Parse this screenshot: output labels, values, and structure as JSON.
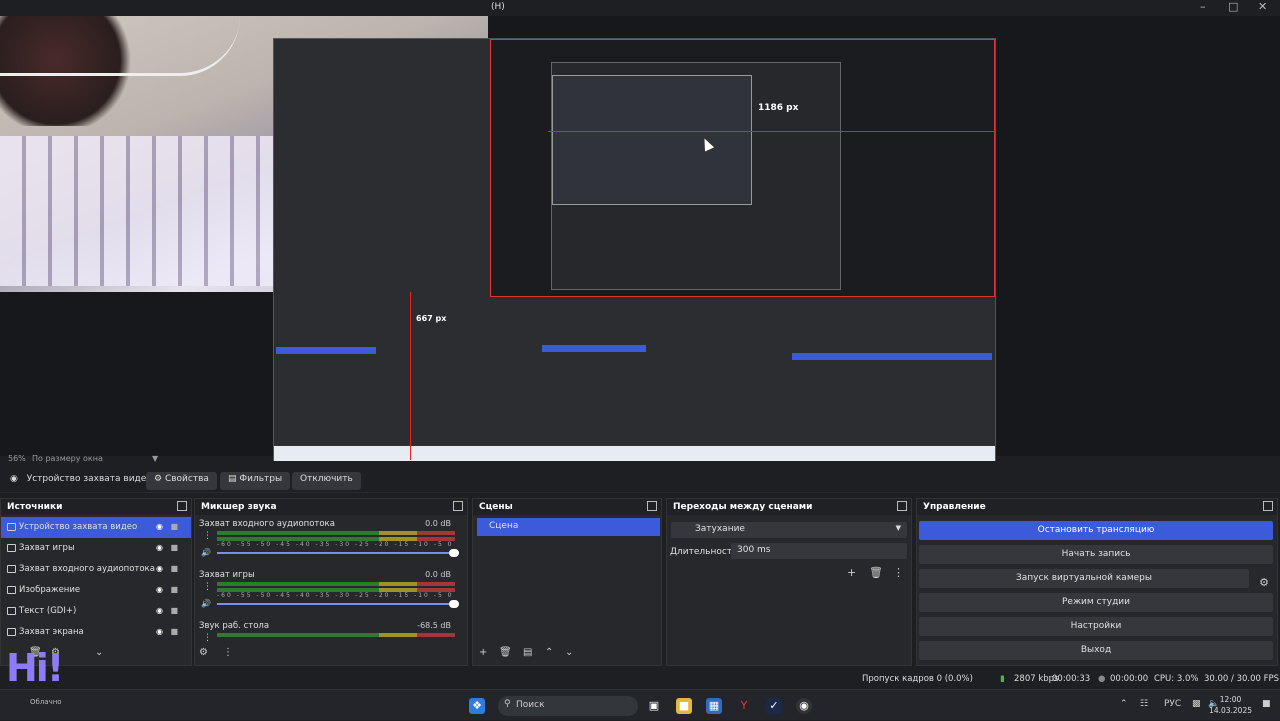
{
  "window": {
    "title": "(H)"
  },
  "preview": {
    "measure_horizontal": "1186 px",
    "measure_vertical": "667 px",
    "zoom_level": "56%",
    "zoom_mode": "По размеру окна"
  },
  "toolbar": {
    "source_name": "Устройство захвата видео",
    "properties": "Свойства",
    "filters": "Фильтры",
    "disable": "Отключить"
  },
  "sources": {
    "title": "Источники",
    "items": [
      {
        "label": "Устройство захвата видео",
        "icon": "camera-icon",
        "selected": true
      },
      {
        "label": "Захват игры",
        "icon": "gamepad-icon"
      },
      {
        "label": "Захват входного аудиопотока",
        "icon": "microphone-icon"
      },
      {
        "label": "Изображение",
        "icon": "image-icon"
      },
      {
        "label": "Текст (GDI+)",
        "icon": "text-icon"
      },
      {
        "label": "Захват экрана",
        "icon": "monitor-icon"
      }
    ]
  },
  "mixer": {
    "title": "Микшер звука",
    "scale": "-60 -55 -50 -45 -40 -35 -30 -25 -20 -15 -10 -5 0",
    "channels": [
      {
        "name": "Захват входного аудиопотока",
        "db": "0.0 dB"
      },
      {
        "name": "Захват игры",
        "db": "0.0 dB"
      },
      {
        "name": "Звук раб. стола",
        "db": "-68.5 dB"
      }
    ]
  },
  "scenes": {
    "title": "Сцены",
    "items": [
      {
        "label": "Сцена",
        "selected": true
      }
    ]
  },
  "transitions": {
    "title": "Переходы между сценами",
    "selected": "Затухание",
    "duration_label": "Длительность",
    "duration_value": "300 ms"
  },
  "controls": {
    "title": "Управление",
    "stop_stream": "Остановить трансляцию",
    "start_recording": "Начать запись",
    "virtual_camera": "Запуск виртуальной камеры",
    "studio_mode": "Режим студии",
    "settings": "Настройки",
    "exit": "Выход"
  },
  "status": {
    "dropped_frames": "Пропуск кадров 0 (0.0%)",
    "bitrate": "2807 kbps",
    "stream_time": "00:00:33",
    "rec_time": "00:00:00",
    "cpu": "CPU: 3.0%",
    "fps": "30.00 / 30.00 FPS"
  },
  "taskbar": {
    "search_placeholder": "Поиск",
    "lang": "РУС",
    "time": "12:00",
    "date": "14.03.2025",
    "weather_big": "Hi!",
    "weather_small": "Облачно"
  },
  "colors": {
    "accent": "#3b5bdb",
    "background": "#1e1f22",
    "dock": "#27282c",
    "guide_red": "#e22222"
  }
}
